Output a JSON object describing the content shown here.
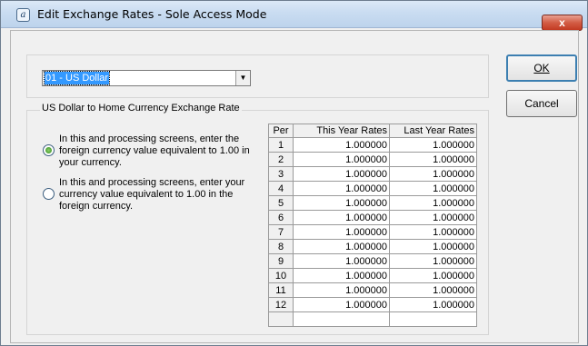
{
  "window": {
    "title": "Edit Exchange Rates - Sole Access Mode",
    "close_label": "x",
    "icon": "app-icon"
  },
  "currency_select": {
    "selected": "01 - US Dollar"
  },
  "buttons": {
    "ok": "OK",
    "cancel": "Cancel"
  },
  "rate_group": {
    "label": "US Dollar to Home Currency Exchange Rate",
    "options": [
      {
        "text": "In this and processing screens, enter the foreign currency value equivalent to 1.00 in your currency.",
        "checked": true
      },
      {
        "text": "In this and processing screens, enter your currency value equivalent to 1.00 in the foreign currency.",
        "checked": false
      }
    ]
  },
  "rates_table": {
    "headers": {
      "per": "Per",
      "this_year": "This Year Rates",
      "last_year": "Last Year Rates"
    },
    "rows": [
      {
        "per": "1",
        "this_year": "1.000000",
        "last_year": "1.000000"
      },
      {
        "per": "2",
        "this_year": "1.000000",
        "last_year": "1.000000"
      },
      {
        "per": "3",
        "this_year": "1.000000",
        "last_year": "1.000000"
      },
      {
        "per": "4",
        "this_year": "1.000000",
        "last_year": "1.000000"
      },
      {
        "per": "5",
        "this_year": "1.000000",
        "last_year": "1.000000"
      },
      {
        "per": "6",
        "this_year": "1.000000",
        "last_year": "1.000000"
      },
      {
        "per": "7",
        "this_year": "1.000000",
        "last_year": "1.000000"
      },
      {
        "per": "8",
        "this_year": "1.000000",
        "last_year": "1.000000"
      },
      {
        "per": "9",
        "this_year": "1.000000",
        "last_year": "1.000000"
      },
      {
        "per": "10",
        "this_year": "1.000000",
        "last_year": "1.000000"
      },
      {
        "per": "11",
        "this_year": "1.000000",
        "last_year": "1.000000"
      },
      {
        "per": "12",
        "this_year": "1.000000",
        "last_year": "1.000000"
      },
      {
        "per": "",
        "this_year": "",
        "last_year": ""
      }
    ]
  }
}
